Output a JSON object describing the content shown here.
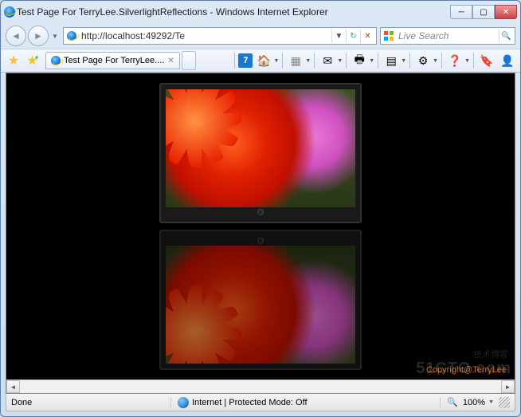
{
  "window": {
    "title": "Test Page For TerryLee.SilverlightReflections - Windows Internet Explorer"
  },
  "nav": {
    "url": "http://localhost:49292/Te",
    "search_placeholder": "Live Search"
  },
  "tab": {
    "title": "Test Page For TerryLee...."
  },
  "page": {
    "copyright": "Copyright@TerryLee",
    "watermark_top": "技术博客",
    "watermark": "51CTO.com"
  },
  "status": {
    "left": "Done",
    "center": "Internet | Protected Mode: Off",
    "zoom": "100%"
  }
}
